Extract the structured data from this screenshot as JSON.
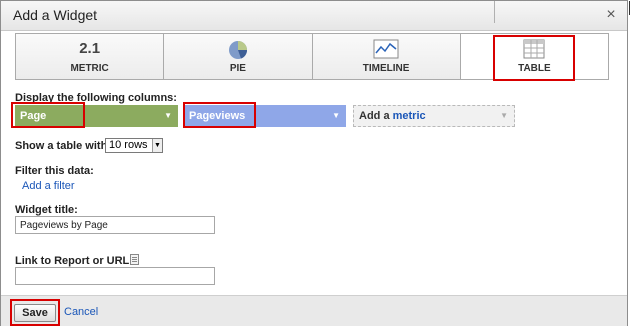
{
  "dialog": {
    "title": "Add a Widget",
    "close_glyph": "×"
  },
  "tabs": [
    {
      "id": "metric",
      "label": "METRIC",
      "icon_text": "2.1",
      "icon": "metric-number-icon"
    },
    {
      "id": "pie",
      "label": "PIE",
      "icon": "pie-chart-icon"
    },
    {
      "id": "timeline",
      "label": "TIMELINE",
      "icon": "timeline-chart-icon"
    },
    {
      "id": "table",
      "label": "TABLE",
      "icon": "table-grid-icon",
      "selected": true
    }
  ],
  "columns": {
    "label": "Display the following columns:",
    "dimension_value": "Page",
    "metric_value": "Pageviews",
    "add_metric_prefix": "Add a",
    "add_metric_link": "metric"
  },
  "rows": {
    "label": "Show a table with",
    "selected": "10 rows"
  },
  "filter": {
    "label": "Filter this data:",
    "link": "Add a filter"
  },
  "widget_title": {
    "label": "Widget title:",
    "value": "Pageviews by Page"
  },
  "link_report": {
    "label": "Link to Report or URL:",
    "value": ""
  },
  "footer": {
    "save_label": "Save",
    "cancel_label": "Cancel"
  },
  "colors": {
    "dimension_select": "#8cab5f",
    "metric_select": "#8fa7e8",
    "highlight": "#d80000",
    "link": "#1a56b8"
  }
}
